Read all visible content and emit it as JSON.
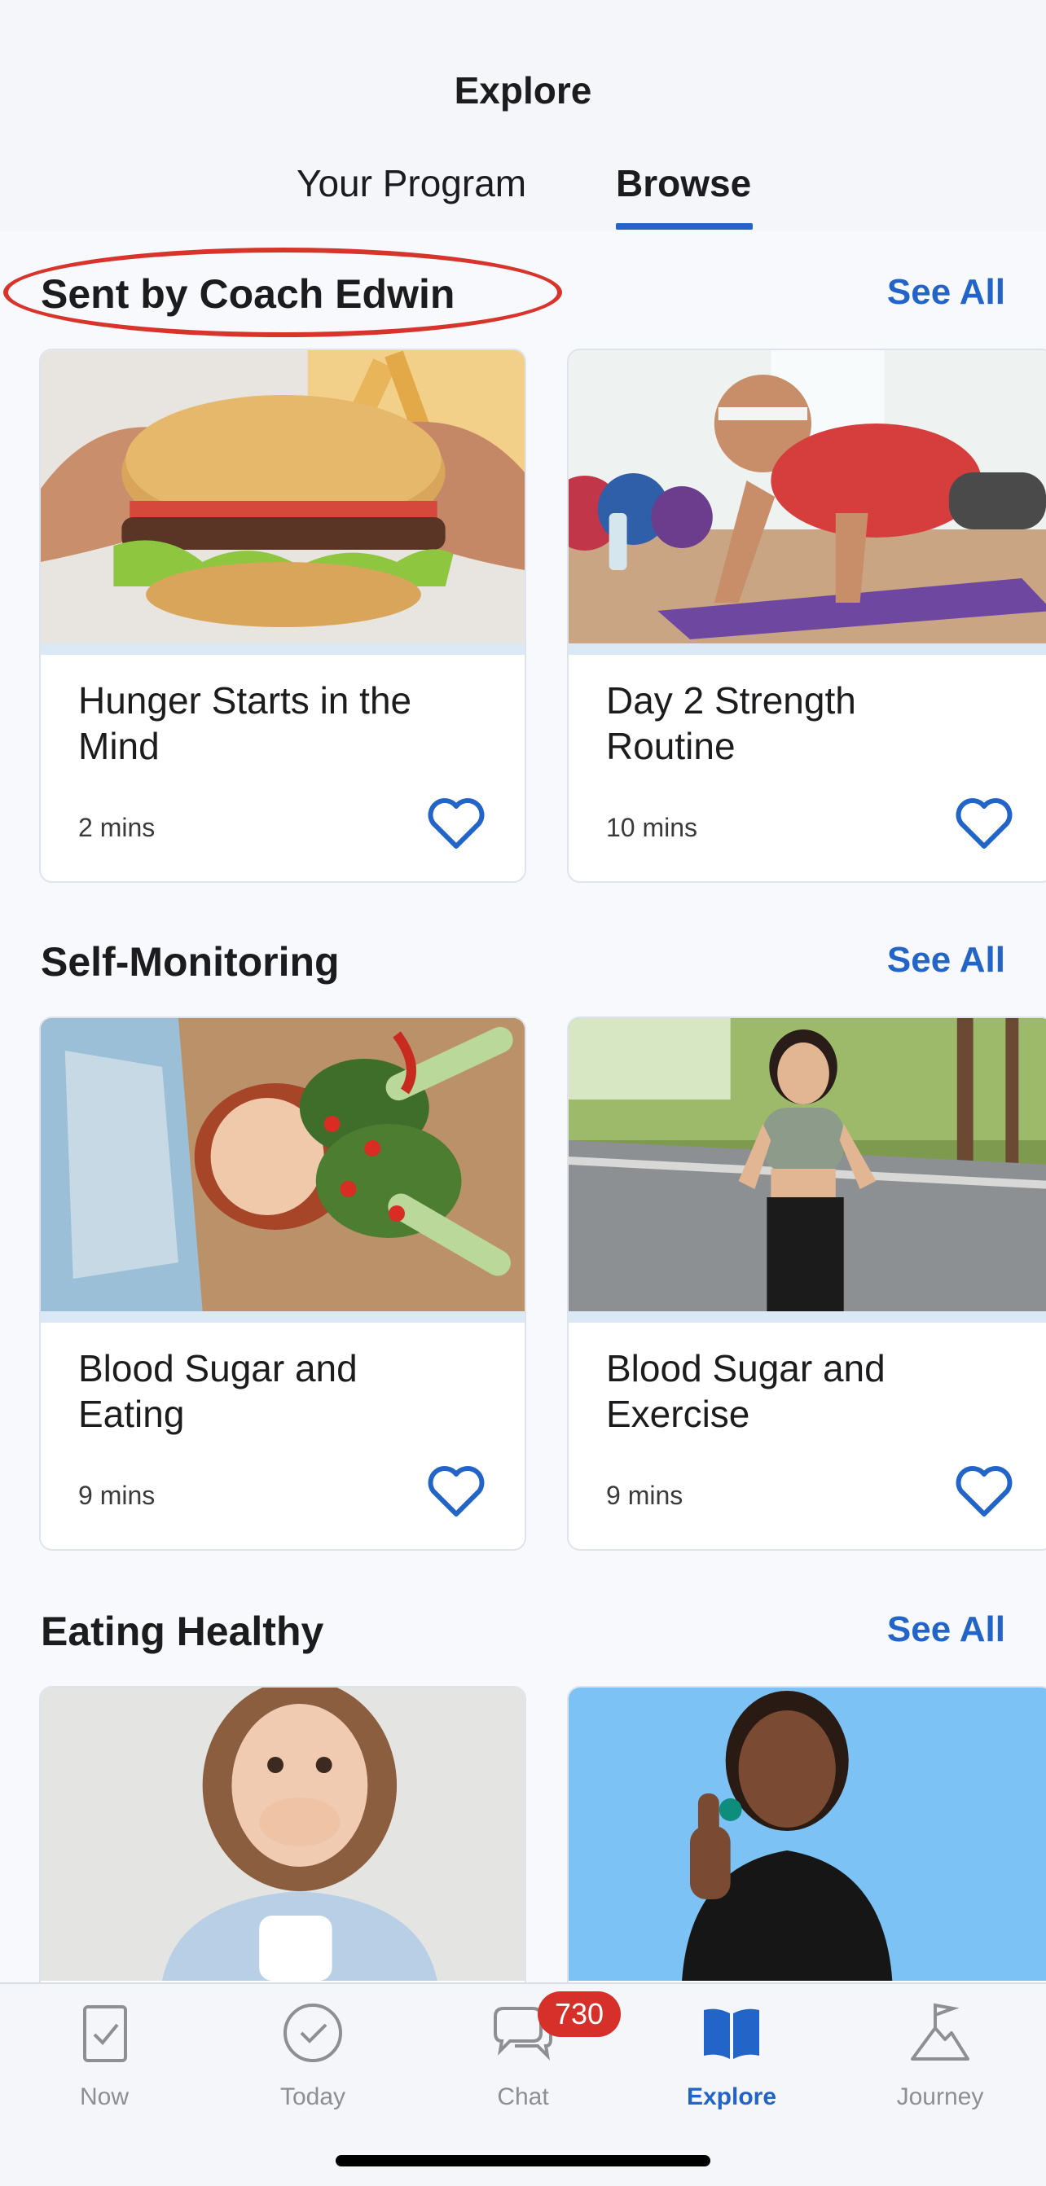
{
  "header": {
    "title": "Explore"
  },
  "tabs": {
    "program": "Your Program",
    "browse": "Browse",
    "active": "Browse"
  },
  "sections": [
    {
      "title": "Sent by Coach Edwin",
      "see_all": "See All",
      "cards": [
        {
          "title": "Hunger Starts in the Mind",
          "duration": "2 mins",
          "image": "hands-holding-burger"
        },
        {
          "title": "Day 2 Strength Routine",
          "duration": "10 mins",
          "image": "woman-pushup-on-mat"
        }
      ]
    },
    {
      "title": "Self-Monitoring",
      "see_all": "See All",
      "cards": [
        {
          "title": "Blood Sugar and Eating",
          "duration": "9 mins",
          "image": "woman-lying-with-vegetables"
        },
        {
          "title": "Blood Sugar and Exercise",
          "duration": "9 mins",
          "image": "woman-jogging-outdoors"
        }
      ]
    },
    {
      "title": "Eating Healthy",
      "see_all": "See All",
      "cards": [
        {
          "image": "surprised-woman-with-mug"
        },
        {
          "image": "woman-thumbs-up-blue-background"
        }
      ]
    }
  ],
  "tabbar": {
    "items": [
      {
        "label": "Now",
        "icon": "clipboard-check-icon"
      },
      {
        "label": "Today",
        "icon": "check-circle-icon"
      },
      {
        "label": "Chat",
        "icon": "chat-bubbles-icon"
      },
      {
        "label": "Explore",
        "icon": "open-book-icon"
      },
      {
        "label": "Journey",
        "icon": "mountain-flag-icon"
      }
    ],
    "active": "Explore",
    "chat_badge": "730"
  },
  "colors": {
    "accent": "#2264c8",
    "badge": "#d7302a",
    "highlight_oval": "#d9342b",
    "background": "#f7f9fc"
  }
}
